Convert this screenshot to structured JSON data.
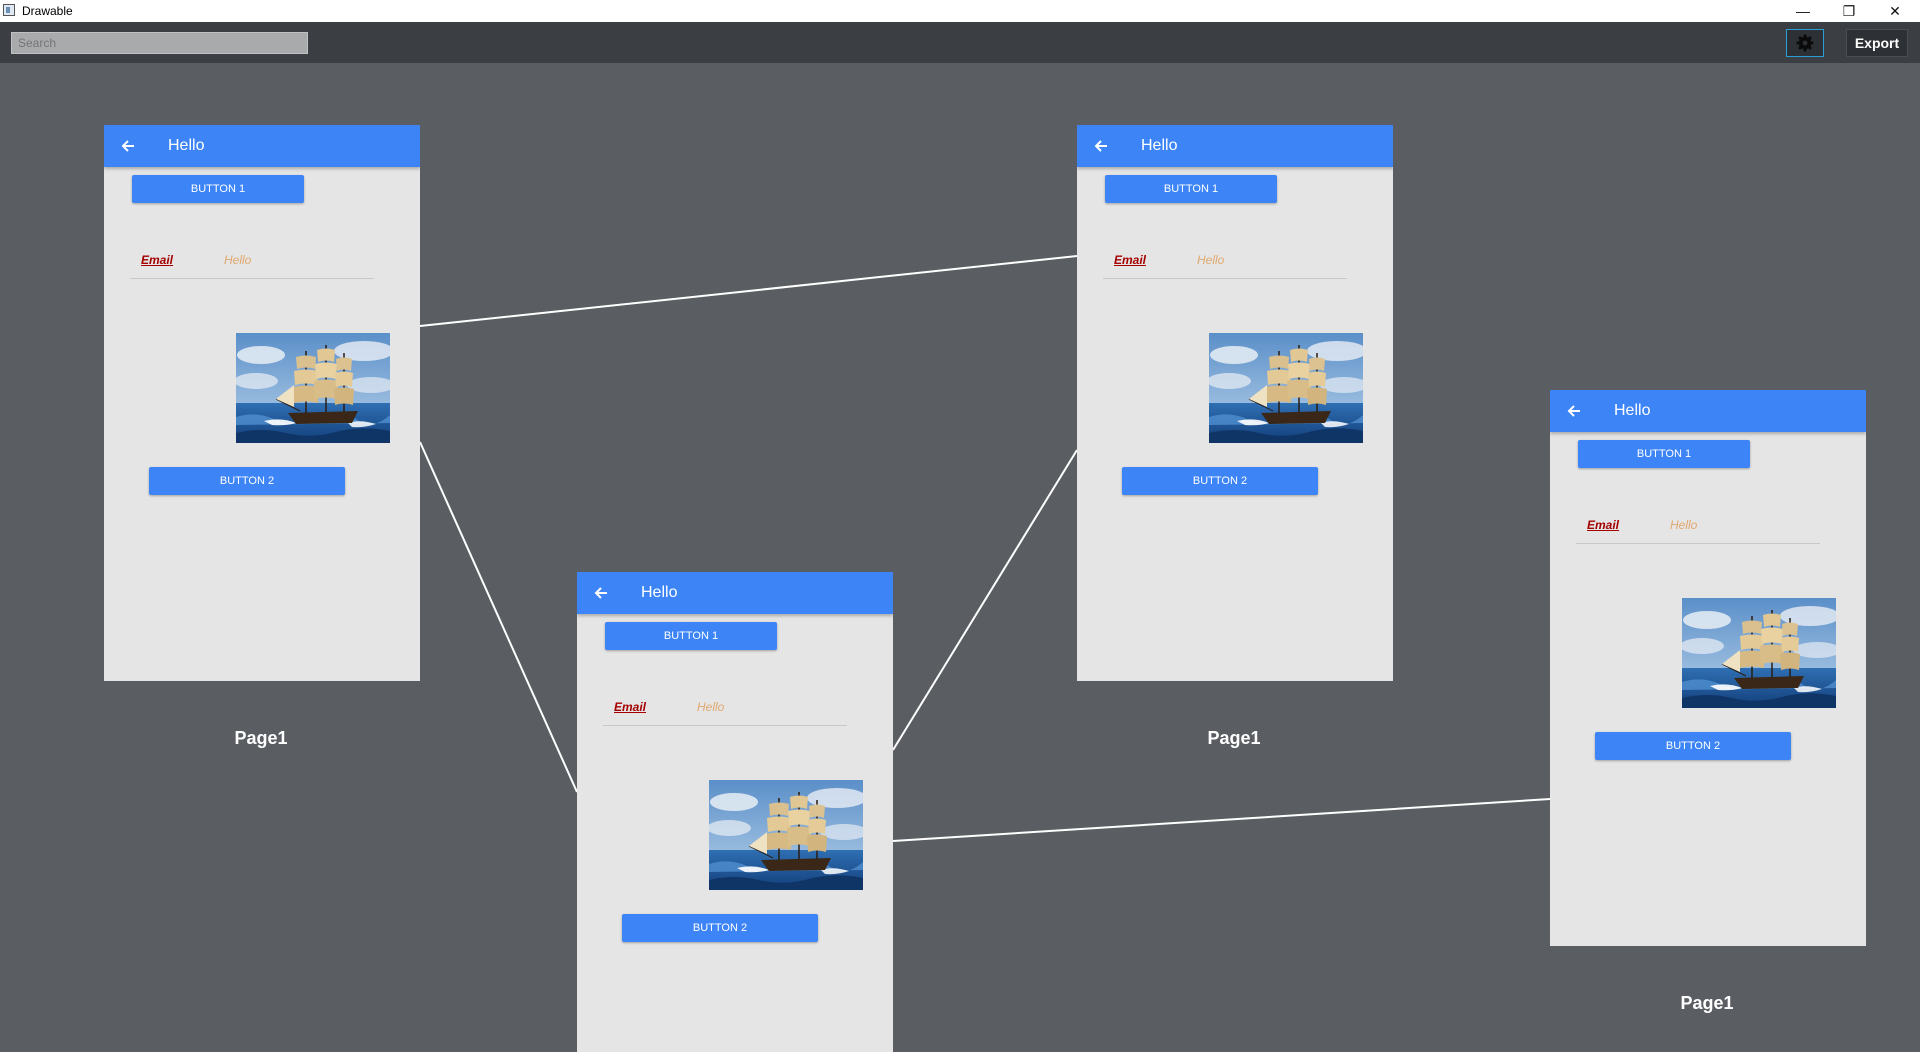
{
  "window": {
    "title": "Drawable",
    "minimize_glyph": "—",
    "restore_glyph": "❐",
    "close_glyph": "✕"
  },
  "toolbar": {
    "search_placeholder": "Search",
    "settings_icon": "gear-icon",
    "export_label": "Export"
  },
  "colors": {
    "canvas": "#5a5e63",
    "toolbar": "#3b3f44",
    "appbar": "#3d85f7",
    "screen_bg": "#e5e5e5",
    "email_text": "#a40000",
    "hello_text": "#e0a86e",
    "connector": "#ffffff"
  },
  "screens": [
    {
      "appbar_title": "Hello",
      "button1": "BUTTON 1",
      "email_label": "Email",
      "hello_label": "Hello",
      "image": "sailing-ship-painting",
      "button2": "BUTTON 2",
      "page_label": "Page1"
    },
    {
      "appbar_title": "Hello",
      "button1": "BUTTON 1",
      "email_label": "Email",
      "hello_label": "Hello",
      "image": "sailing-ship-painting",
      "button2": "BUTTON 2",
      "page_label": "Page1"
    },
    {
      "appbar_title": "Hello",
      "button1": "BUTTON 1",
      "email_label": "Email",
      "hello_label": "Hello",
      "image": "sailing-ship-painting",
      "button2": "BUTTON 2"
    },
    {
      "appbar_title": "Hello",
      "button1": "BUTTON 1",
      "email_label": "Email",
      "hello_label": "Hello",
      "image": "sailing-ship-painting",
      "button2": "BUTTON 2",
      "page_label": "Page1"
    }
  ]
}
